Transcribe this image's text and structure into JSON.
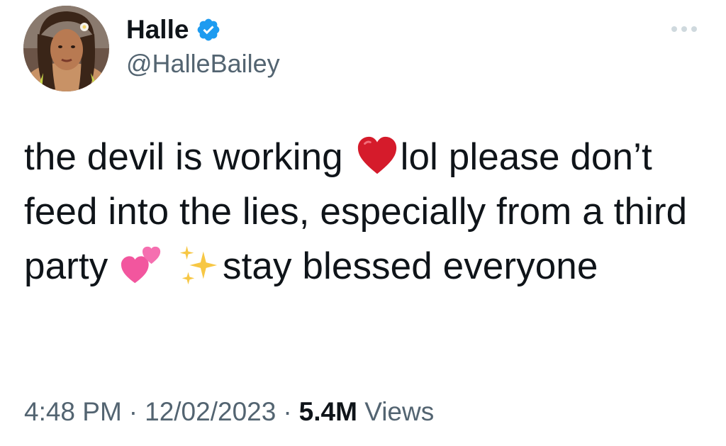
{
  "author": {
    "display_name": "Halle",
    "handle": "@HalleBailey",
    "verified": true,
    "avatar_icon": "profile-photo"
  },
  "tweet": {
    "text_part1": "the devil is working",
    "emoji1": "red-heart-icon",
    "text_part2": "lol please don’t feed into the lies, especially from a third party",
    "emoji2": "two-hearts-icon",
    "emoji3": "sparkles-icon",
    "text_part3": "stay blessed everyone"
  },
  "meta": {
    "time": "4:48 PM",
    "separator": "·",
    "date": "12/02/2023",
    "views_count": "5.4M",
    "views_label": "Views"
  },
  "colors": {
    "text_primary": "#0f1419",
    "text_secondary": "#536471",
    "verified_blue": "#1d9bf0",
    "heart_red": "#d51b2b",
    "pink": "#f2569e",
    "sparkle_gold": "#f7c744"
  }
}
